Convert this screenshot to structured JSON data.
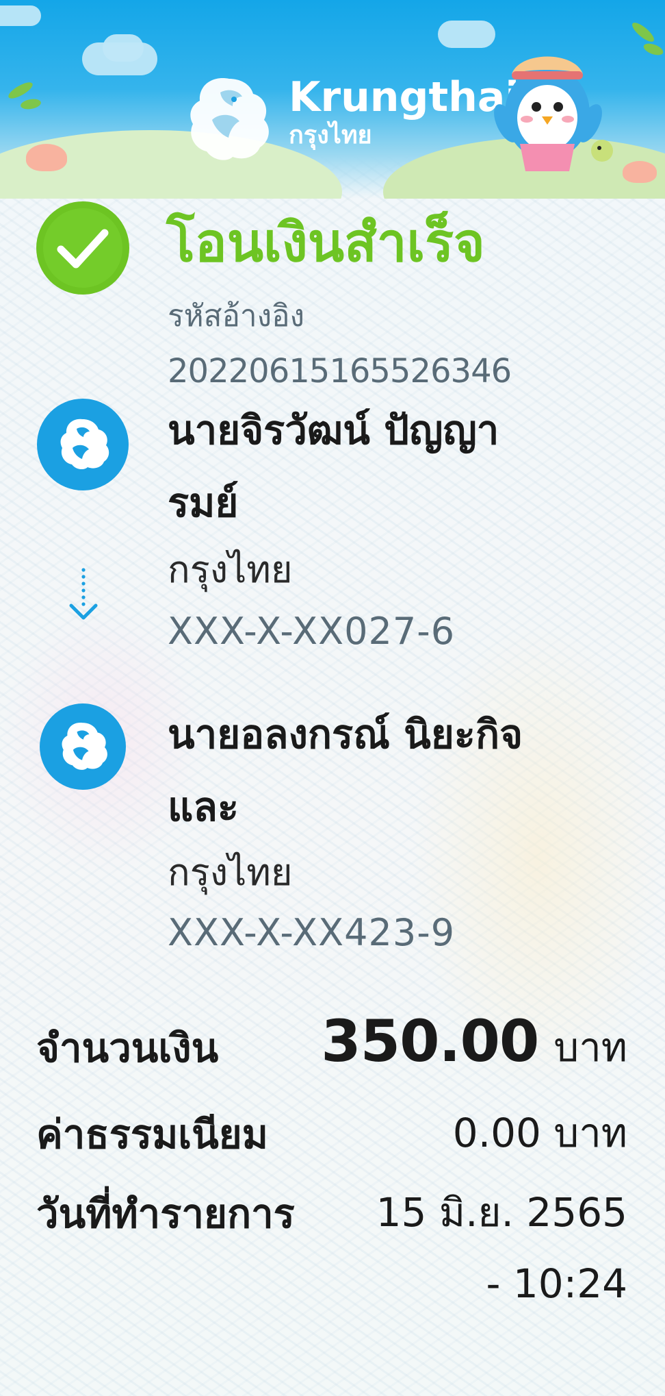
{
  "brand": {
    "name_en": "Krungthai",
    "name_th": "กรุงไทย"
  },
  "status": {
    "title": "โอนเงินสำเร็จ",
    "ref_label": "รหัสอ้างอิง",
    "ref_value": "2022061516552634​6"
  },
  "sender": {
    "name_line1": "นายจิรวัฒน์ ปัญญา",
    "name_line2": "รมย์",
    "bank": "กรุงไทย",
    "account": "XXX-X-XX027-6"
  },
  "receiver": {
    "name_line1": "นายอลงกรณ์ นิยะกิจ",
    "name_line2": "และ",
    "bank": "กรุงไทย",
    "account": "XXX-X-XX423-9"
  },
  "details": {
    "amount_label": "จำนวนเงิน",
    "amount_value": "350.00",
    "amount_unit": "บาท",
    "fee_label": "ค่าธรรมเนียม",
    "fee_value": "0.00 บาท",
    "date_label": "วันที่ทำรายการ",
    "date_value": "15 มิ.ย. 2565",
    "time_value": "- 10:24"
  },
  "colors": {
    "success_green": "#6dc423",
    "brand_blue": "#1ba0e2",
    "secondary_text": "#596b77"
  },
  "icons": {
    "status": "check-circle-icon",
    "bank": "krungthai-bird-logo",
    "transfer": "arrow-down-icon"
  }
}
